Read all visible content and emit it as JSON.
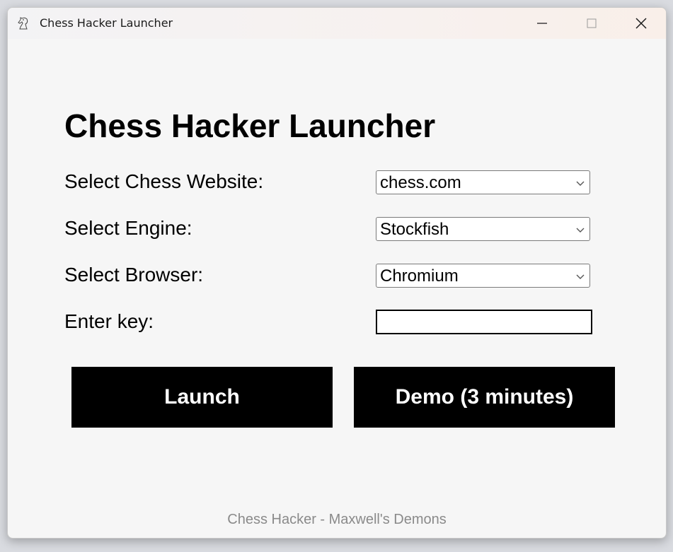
{
  "window": {
    "title": "Chess Hacker Launcher",
    "icon": "chess-knight-icon",
    "controls": [
      "minimize-icon",
      "maximize-icon",
      "close-icon"
    ]
  },
  "main": {
    "heading": "Chess Hacker Launcher",
    "fields": [
      {
        "label": "Select Chess Website:",
        "value": "chess.com"
      },
      {
        "label": "Select Engine:",
        "value": "Stockfish"
      },
      {
        "label": "Select Browser:",
        "value": "Chromium"
      },
      {
        "label": "Enter key:",
        "value": "",
        "placeholder": ""
      }
    ],
    "launch_label": "Launch",
    "demo_label": "Demo (3 minutes)"
  },
  "footer": {
    "text": "Chess Hacker - Maxwell's Demons"
  },
  "colors": {
    "button_bg": "#000000",
    "button_text": "#ffffff",
    "window_bg": "#f6f6f6",
    "footer_text": "#8a8a8a"
  }
}
